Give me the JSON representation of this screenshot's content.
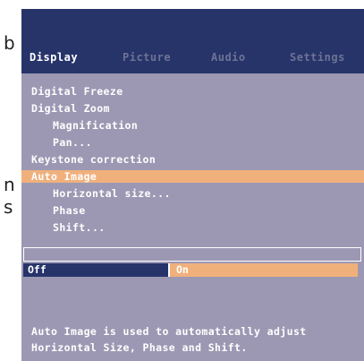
{
  "background_doc": {
    "char_1": "b",
    "char_2": "n",
    "char_3": "s"
  },
  "tabs": [
    {
      "label": "Display",
      "active": true
    },
    {
      "label": "Picture",
      "active": false
    },
    {
      "label": "Audio",
      "active": false
    },
    {
      "label": "Settings",
      "active": false
    }
  ],
  "menu": {
    "items": [
      {
        "label": "Digital Freeze",
        "level": 0,
        "selected": false
      },
      {
        "label": "Digital Zoom",
        "level": 0,
        "selected": false
      },
      {
        "label": "Magnification",
        "level": 1,
        "selected": false
      },
      {
        "label": "Pan...",
        "level": 1,
        "selected": false
      },
      {
        "label": "Keystone correction",
        "level": 0,
        "selected": false
      },
      {
        "label": "Auto Image",
        "level": 0,
        "selected": true
      },
      {
        "label": "Horizontal size...",
        "level": 1,
        "selected": false
      },
      {
        "label": "Phase",
        "level": 1,
        "selected": false
      },
      {
        "label": "Shift...",
        "level": 1,
        "selected": false
      }
    ]
  },
  "options": {
    "off_label": "Off",
    "on_label": "On",
    "selected": "On"
  },
  "help": {
    "line1": "Auto Image is used to automatically adjust",
    "line2": "Horizontal Size, Phase and Shift."
  },
  "colors": {
    "header": "#27346a",
    "menu_background": "#9c98b3",
    "highlight": "#f0b07c",
    "text": "#ffffff",
    "inactive_tab": "#6d7395"
  }
}
